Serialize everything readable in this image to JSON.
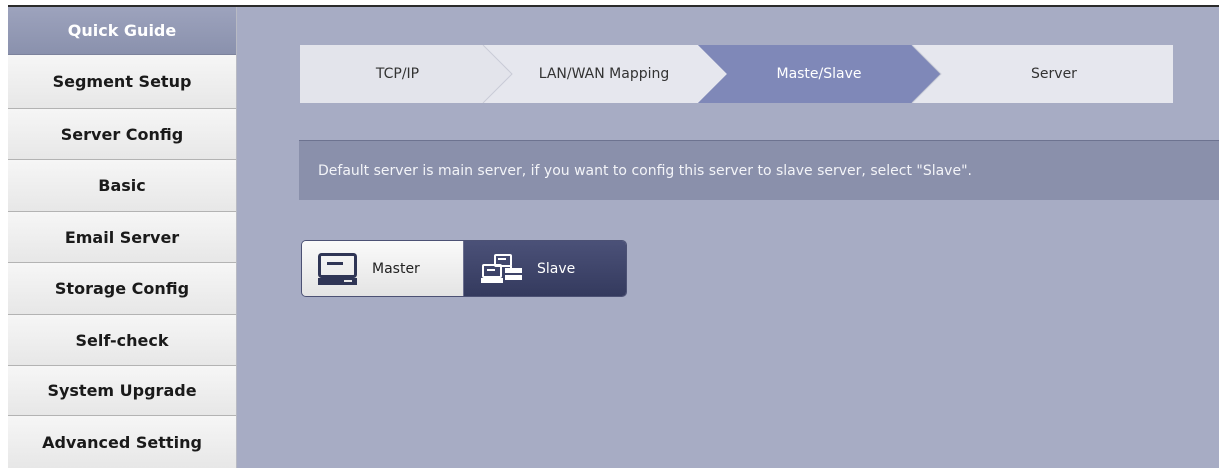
{
  "sidebar": {
    "items": [
      {
        "label": "Quick Guide",
        "active": true
      },
      {
        "label": "Segment Setup"
      },
      {
        "label": "Server Config"
      },
      {
        "label": "Basic"
      },
      {
        "label": "Email Server"
      },
      {
        "label": "Storage Config"
      },
      {
        "label": "Self-check"
      },
      {
        "label": "System Upgrade"
      },
      {
        "label": "Advanced Setting"
      }
    ]
  },
  "wizard": {
    "steps": [
      {
        "label": "TCP/IP"
      },
      {
        "label": "LAN/WAN Mapping"
      },
      {
        "label": "Maste/Slave",
        "active": true
      },
      {
        "label": "Server"
      }
    ]
  },
  "info": {
    "text": "Default server is main server, if you want to config this server to slave server, select \"Slave\"."
  },
  "mode_toggle": {
    "master_label": "Master",
    "slave_label": "Slave",
    "selected": "Slave",
    "master_icon": "server-icon",
    "slave_icon": "network-servers-icon"
  },
  "colors": {
    "main_bg": "#a7acc4",
    "sidebar_active": "#9299b4",
    "step_active": "#7f88b8",
    "step_inactive": "#e3e4eb",
    "info_bar": "#8a90ab",
    "slave_selected": "#3c4268"
  }
}
